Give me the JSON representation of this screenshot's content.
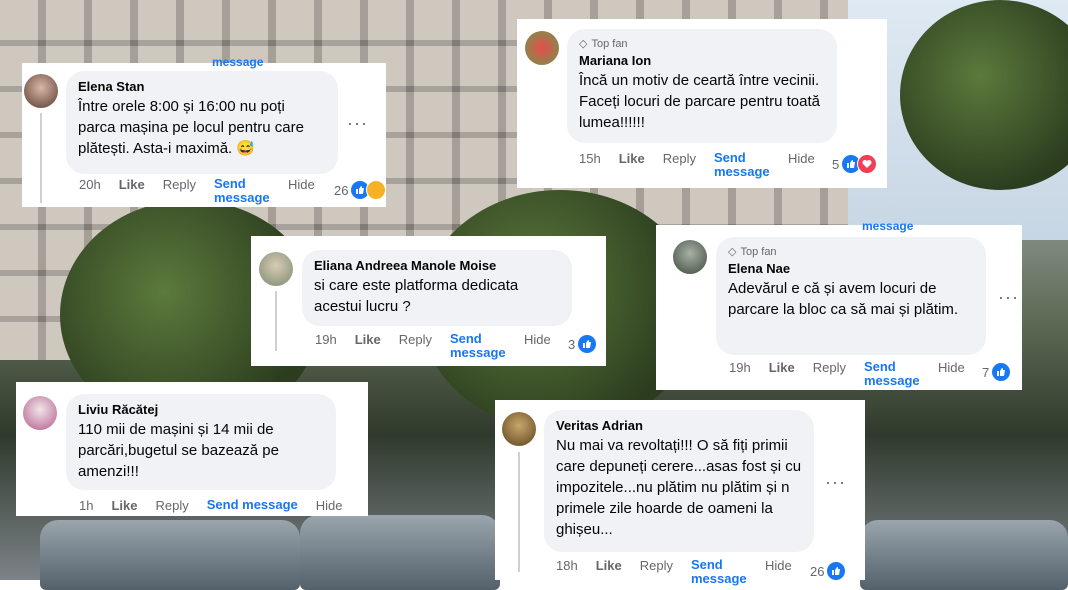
{
  "ui": {
    "like": "Like",
    "reply": "Reply",
    "send": "Send message",
    "hide": "Hide",
    "top_fan": "Top fan",
    "dots": "···"
  },
  "comments": [
    {
      "name": "Elena Stan",
      "text": "Între orele 8:00 și 16:00 nu poți parca mașina pe locul pentru care plătești. Asta-i maximă. 😅",
      "time": "20h",
      "count": "26",
      "reactions": [
        "like",
        "haha"
      ]
    },
    {
      "name": "Mariana Ion",
      "top_fan": true,
      "text": "Încă un motiv de ceartă între vecinii. Faceți locuri de parcare pentru toată lumea!!!!!!",
      "time": "15h",
      "count": "5",
      "reactions": [
        "like",
        "love"
      ]
    },
    {
      "name": "Eliana Andreea Manole Moise",
      "text": "si care este platforma dedicata acestui lucru ?",
      "time": "19h",
      "count": "3",
      "reactions": [
        "like"
      ]
    },
    {
      "name": "Elena Nae",
      "top_fan": true,
      "text": "Adevărul e că și avem locuri de parcare la bloc ca să mai și plătim.",
      "time": "19h",
      "count": "7",
      "reactions": [
        "like"
      ]
    },
    {
      "name": "Liviu Răcătej",
      "text": "110 mii de mașini și 14 mii de parcări,bugetul se bazează pe amenzi!!!",
      "time": "1h",
      "count": "",
      "reactions": []
    },
    {
      "name": "Veritas Adrian",
      "text": "Nu mai va revoltați!!! O să fiți primii care depuneți cerere...asas fost și cu impozitele...nu plătim nu plătim și n primele zile hoarde de oameni la ghișeu...",
      "time": "18h",
      "count": "26",
      "reactions": [
        "like"
      ]
    }
  ],
  "peek": {
    "time_1h": "1h",
    "send_cut": "message"
  },
  "colors": {
    "link": "#1877f2",
    "bubble": "#f0f2f5",
    "muted": "#65676b"
  }
}
